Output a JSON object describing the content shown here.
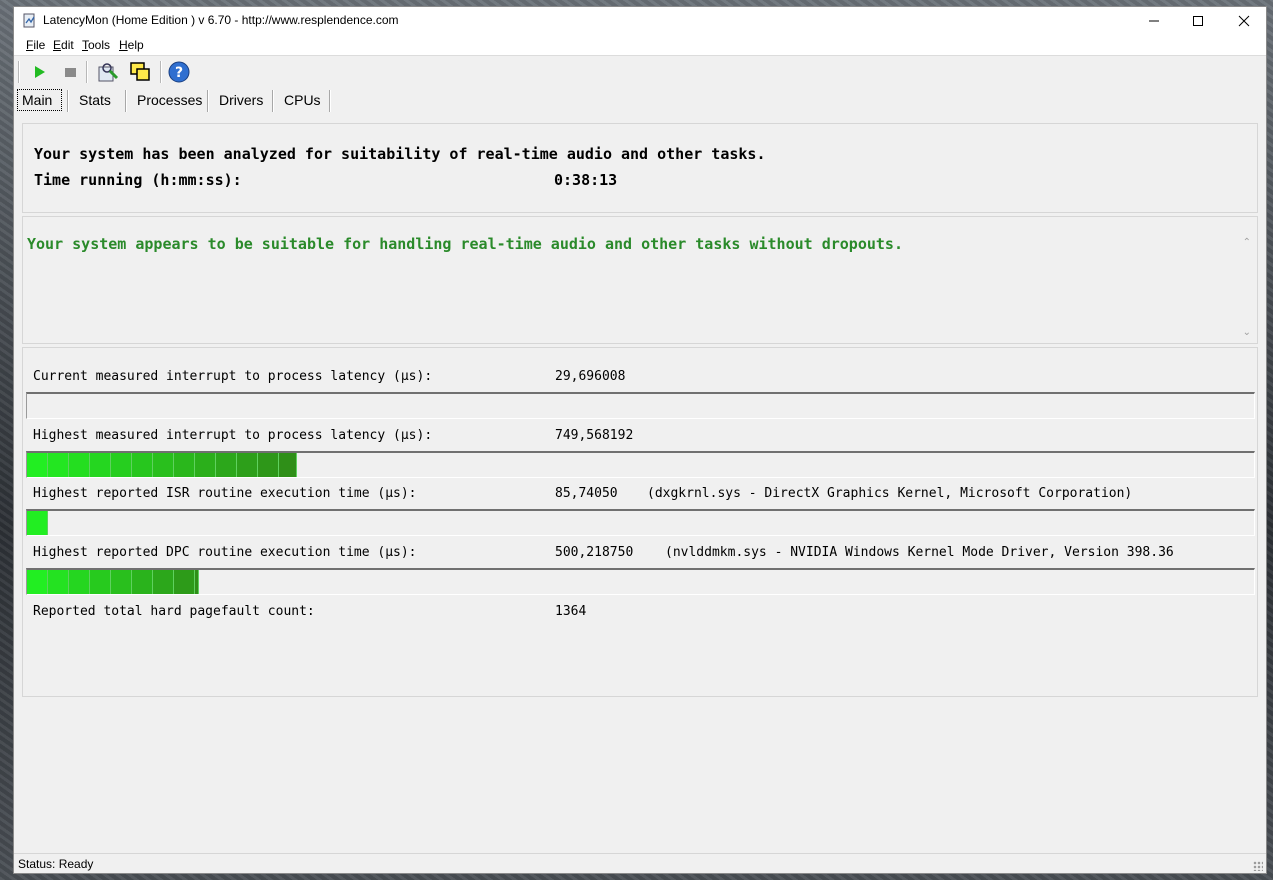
{
  "window": {
    "title": "LatencyMon  (Home Edition )  v 6.70 - http://www.resplendence.com"
  },
  "menu": [
    "File",
    "Edit",
    "Tools",
    "Help"
  ],
  "toolbar": {
    "buttons": [
      "play-icon",
      "stop-icon",
      "report-icon",
      "windows-icon",
      "help-icon"
    ]
  },
  "tabs": [
    "Main",
    "Stats",
    "Processes",
    "Drivers",
    "CPUs"
  ],
  "summary": {
    "analyzed_text": "Your system has been analyzed for suitability of real-time audio and other tasks.",
    "time_label": "Time running (h:mm:ss):",
    "time_value": "0:38:13"
  },
  "verdict": {
    "text": "Your system appears to be suitable for handling real-time audio and other tasks without dropouts.",
    "color": "#2a8a2a"
  },
  "stats": [
    {
      "label": "Current measured interrupt to process latency (µs):",
      "value": "29,696008",
      "detail": "",
      "bar_fraction": 0.0
    },
    {
      "label": "Highest measured interrupt to process latency (µs):",
      "value": "749,568192",
      "detail": "",
      "bar_fraction": 0.22
    },
    {
      "label": "Highest reported ISR routine execution time (µs):",
      "value": "85,74050",
      "detail": "(dxgkrnl.sys - DirectX Graphics Kernel, Microsoft Corporation)",
      "bar_fraction": 0.017
    },
    {
      "label": "Highest reported DPC routine execution time (µs):",
      "value": "500,218750",
      "detail": "(nvlddmkm.sys - NVIDIA Windows Kernel Mode Driver, Version 398.36",
      "bar_fraction": 0.14
    },
    {
      "label": "Reported total hard pagefault count:",
      "value": "1364",
      "detail": ""
    }
  ],
  "status": {
    "text": "Status: Ready"
  },
  "colors": {
    "bar_light": "#22ee22",
    "bar_dark": "#2f8f18"
  }
}
